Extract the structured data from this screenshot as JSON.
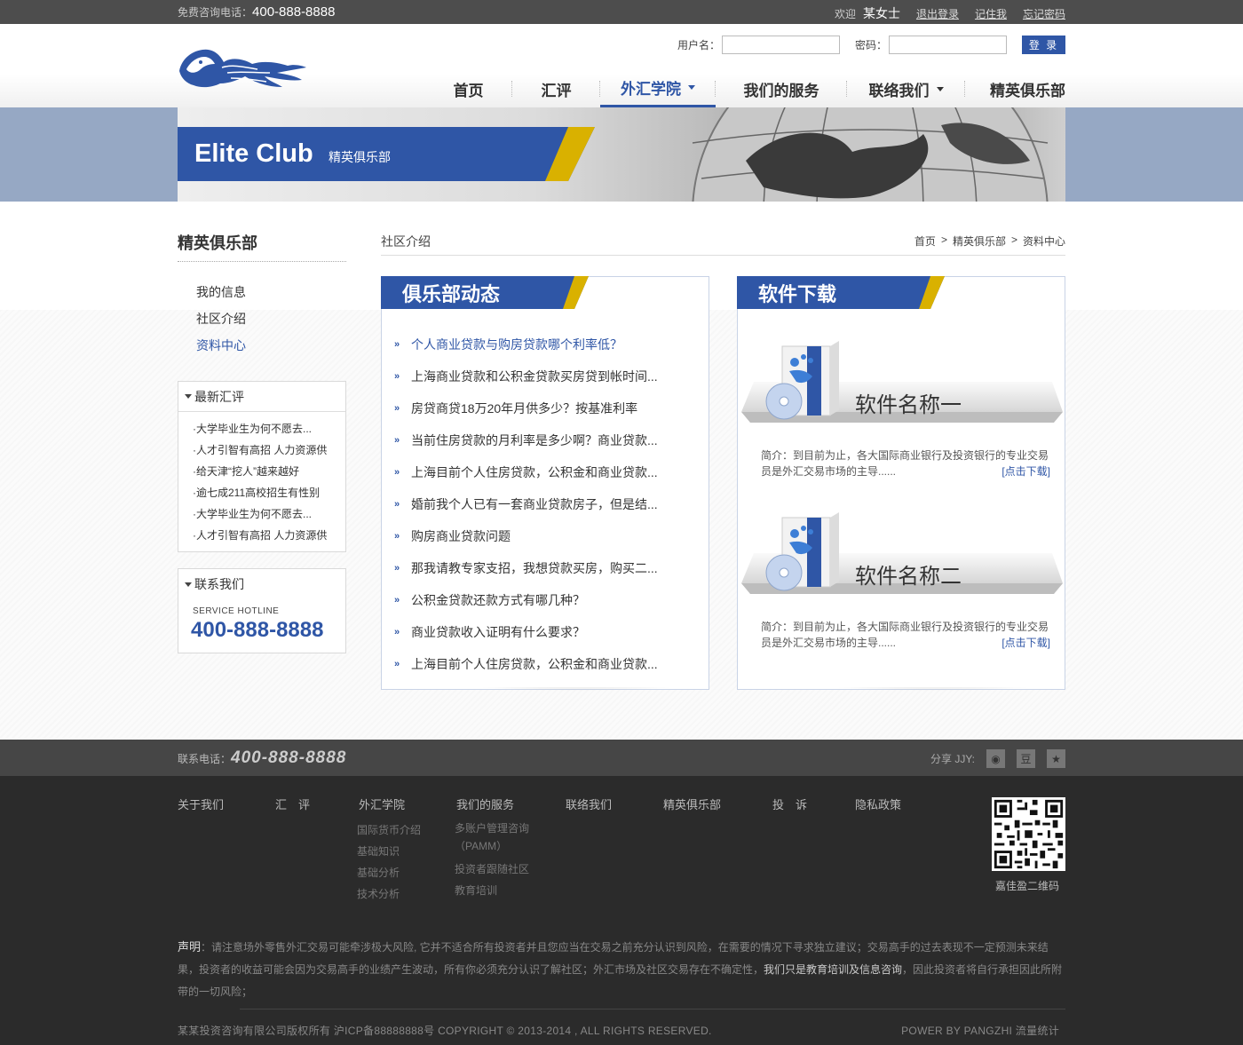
{
  "topbar": {
    "hotline_label": "免费咨询电话：",
    "hotline_number": "400-888-8888",
    "welcome": "欢迎",
    "user": "某女士",
    "logout": "退出登录",
    "remember": "记住我",
    "forgot": "忘记密码"
  },
  "login": {
    "username_label": "用户名：",
    "password_label": "密码：",
    "submit": "登 录"
  },
  "nav": [
    {
      "label": "首页"
    },
    {
      "label": "汇评"
    },
    {
      "label": "外汇学院"
    },
    {
      "label": "我们的服务"
    },
    {
      "label": "联络我们"
    },
    {
      "label": "精英俱乐部"
    }
  ],
  "banner": {
    "title": "Elite Club",
    "subtitle": "精英俱乐部"
  },
  "sidebar": {
    "title": "精英俱乐部",
    "menu": [
      "我的信息",
      "社区介绍",
      "资料中心"
    ],
    "latest": {
      "title": "最新汇评",
      "items": [
        "·大学毕业生为何不愿去...",
        "·人才引智有高招 人力资源供",
        "·给天津“挖人”越来越好",
        "·逾七成211高校招生有性别",
        "·大学毕业生为何不愿去...",
        "·人才引智有高招 人力资源供"
      ]
    },
    "contact": {
      "title": "联系我们",
      "hotline_en": "SERVICE HOTLINE",
      "hotline": "400-888-8888"
    }
  },
  "breadcrumb": {
    "section": "社区介绍",
    "path": [
      "首页",
      ">",
      "精英俱乐部",
      ">",
      "资料中心"
    ]
  },
  "club_news": {
    "title": "俱乐部动态",
    "items": [
      "个人商业贷款与购房贷款哪个利率低？",
      "上海商业贷款和公积金贷款买房贷到帐时间...",
      "房贷商贷18万20年月供多少？按基准利率",
      "当前住房贷款的月利率是多少啊？商业贷款...",
      "上海目前个人住房贷款，公积金和商业贷款...",
      "婚前我个人已有一套商业贷款房子，但是结...",
      "购房商业贷款问题",
      "那我请教专家支招，我想贷款买房，购买二...",
      "公积金贷款还款方式有哪几种？",
      "商业贷款收入证明有什么要求？",
      "上海目前个人住房贷款，公积金和商业贷款..."
    ]
  },
  "software": {
    "title": "软件下载",
    "items": [
      {
        "name": "软件名称一",
        "desc": "简介：到目前为止，各大国际商业银行及投资银行的专业交易员是外汇交易市场的主导......",
        "link": "[点击下载]"
      },
      {
        "name": "软件名称二",
        "desc": "简介：到目前为止，各大国际商业银行及投资银行的专业交易员是外汇交易市场的主导......",
        "link": "[点击下载]"
      }
    ]
  },
  "footer": {
    "tel_label": "联系电话：",
    "tel": "400-888-8888",
    "share_label": "分享 JJY:",
    "share_icons": [
      "weibo-icon",
      "douban-icon",
      "favorite-icon"
    ],
    "cols": [
      {
        "title": "关于我们",
        "items": []
      },
      {
        "title": "汇　评",
        "items": []
      },
      {
        "title": "外汇学院",
        "items": [
          "国际货币介绍",
          "基础知识",
          "基础分析",
          "技术分析"
        ]
      },
      {
        "title": "我们的服务",
        "items": [
          "多账户管理咨询（PAMM）",
          "投资者跟随社区",
          "教育培训"
        ]
      },
      {
        "title": "联络我们",
        "items": []
      },
      {
        "title": "精英俱乐部",
        "items": []
      },
      {
        "title": "投　诉",
        "items": []
      },
      {
        "title": "隐私政策",
        "items": []
      }
    ],
    "qr_label": "嘉佳盈二维码",
    "declaration_label": "声明",
    "declaration_a": "：请注意场外零售外汇交易可能牵涉极大风险, 它并不适合所有投资者并且您应当在交易之前充分认识到风险，在需要的情况下寻求独立建议；交易高手的过去表现不一定预测未来结果，投资者的收益可能会因为交易高手的业绩产生波动，所有你必须充分认识了解社区；外汇市场及社区交易存在不确定性，",
    "declaration_b": "我们只是教育培训及信息咨询",
    "declaration_c": "，因此投资者将自行承担因此所附带的一切风险；",
    "copyright": "某某投资咨询有限公司版权所有 沪ICP备88888888号 COPYRIGHT © 2013-2014 , ALL RIGHTS RESERVED.",
    "power": "POWER BY PANGZHI  流量统计"
  },
  "colors": {
    "brand_blue": "#2f56a6",
    "accent_yellow": "#d9b100",
    "banner_bg": "#96a8c4",
    "footer_bg": "#2b2b2b"
  }
}
